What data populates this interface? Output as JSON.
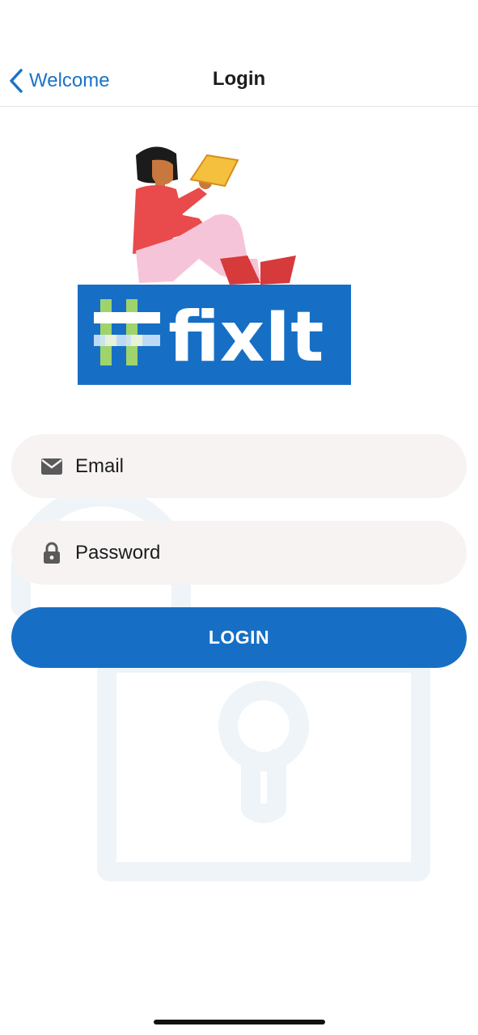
{
  "navbar": {
    "back_label": "Welcome",
    "title": "Login"
  },
  "brand": {
    "logo_text": "fixIt",
    "logo_bg": "#166fc4"
  },
  "form": {
    "email_placeholder": "Email",
    "password_placeholder": "Password",
    "login_label": "LOGIN"
  },
  "colors": {
    "accent": "#166fc4",
    "link": "#1a73c7",
    "field_bg": "#f7f3f2"
  },
  "icons": {
    "back": "chevron-left-icon",
    "email": "mail-icon",
    "password": "lock-icon",
    "background": "padlock-icon"
  }
}
